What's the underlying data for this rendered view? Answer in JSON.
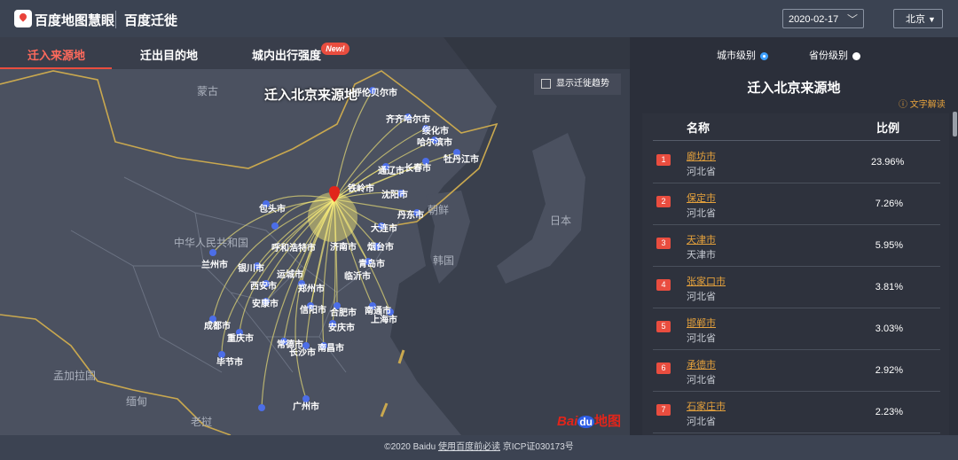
{
  "header": {
    "logo_text": "百度地图慧眼",
    "app_title": "百度迁徙",
    "date": "2020-02-17",
    "city": "北京"
  },
  "tabs": [
    {
      "label": "迁入来源地"
    },
    {
      "label": "迁出目的地"
    },
    {
      "label": "城内出行强度"
    }
  ],
  "new_badge": "New!",
  "map": {
    "title": "迁入北京来源地",
    "trend_toggle": "显示迁徙趋势",
    "country_labels": [
      "蒙古",
      "中华人民共和国",
      "朝鲜",
      "韩国",
      "日本",
      "缅甸",
      "孟加拉国",
      "老挝"
    ],
    "city_labels": [
      "呼伦贝尔市",
      "齐齐哈尔市",
      "绥化市",
      "哈尔滨市",
      "牡丹江市",
      "通辽市",
      "长春市",
      "沈阳市",
      "铁岭市",
      "丹东市",
      "大连市",
      "烟台市",
      "青岛市",
      "包头市",
      "呼和浩特市",
      "兰州市",
      "银川市",
      "西安市",
      "安康市",
      "郑州市",
      "信阳市",
      "合肥市",
      "南通市",
      "上海市",
      "安庆市",
      "成都市",
      "重庆市",
      "常德市",
      "长沙市",
      "南昌市",
      "毕节市",
      "广州市",
      "运城市",
      "临沂市",
      "济南市"
    ],
    "baidu_logo": {
      "a": "Bai",
      "b": "du",
      "c": "地图"
    }
  },
  "panel": {
    "level_city": "城市级别",
    "level_province": "省份级别",
    "title": "迁入北京来源地",
    "explain": "文字解读",
    "col_name": "名称",
    "col_ratio": "比例",
    "rows": [
      {
        "rank": "1",
        "name": "廊坊市",
        "province": "河北省",
        "pct": "23.96%"
      },
      {
        "rank": "2",
        "name": "保定市",
        "province": "河北省",
        "pct": "7.26%"
      },
      {
        "rank": "3",
        "name": "天津市",
        "province": "天津市",
        "pct": "5.95%"
      },
      {
        "rank": "4",
        "name": "张家口市",
        "province": "河北省",
        "pct": "3.81%"
      },
      {
        "rank": "5",
        "name": "邯郸市",
        "province": "河北省",
        "pct": "3.03%"
      },
      {
        "rank": "6",
        "name": "承德市",
        "province": "河北省",
        "pct": "2.92%"
      },
      {
        "rank": "7",
        "name": "石家庄市",
        "province": "河北省",
        "pct": "2.23%"
      }
    ]
  },
  "footer": {
    "copyright": "©2020 Baidu",
    "link": "使用百度前必读",
    "icp": "京ICP证030173号"
  },
  "colors": {
    "accent": "#e94d3f",
    "link": "#e6a23c",
    "flow": "#fff27a"
  }
}
